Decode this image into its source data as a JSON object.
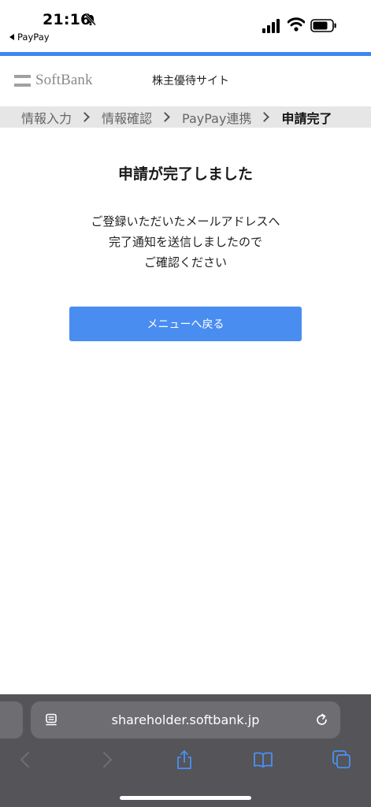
{
  "status_bar": {
    "time": "21:16",
    "back_app": "PayPay"
  },
  "header": {
    "logo_text": "SoftBank",
    "site_name": "株主優待サイト",
    "accent_color": "#3c87f0"
  },
  "breadcrumb": {
    "steps": [
      "情報入力",
      "情報確認",
      "PayPay連携",
      "申請完了"
    ],
    "current_index": 3
  },
  "main": {
    "title": "申請が完了しました",
    "message_lines": [
      "ご登録いただいたメールアドレスへ",
      "完了通知を送信しましたので",
      "ご確認ください"
    ],
    "button_label": "メニューへ戻る",
    "button_color": "#4a8df0"
  },
  "browser": {
    "url": "shareholder.softbank.jp",
    "icons": [
      "page-menu-icon",
      "reload-icon",
      "back-icon",
      "forward-icon",
      "share-icon",
      "bookmarks-icon",
      "tabs-icon"
    ]
  }
}
